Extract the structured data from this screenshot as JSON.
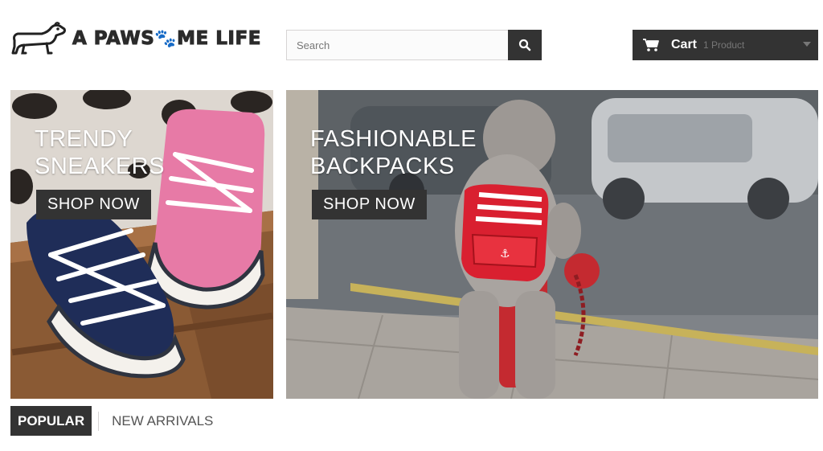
{
  "header": {
    "logo_text_left": "A PAWS",
    "logo_text_right": "ME LIFE",
    "logo_paw_glyph": "🐾",
    "search_placeholder": "Search",
    "cart_label": "Cart",
    "cart_count": "1 Product"
  },
  "banners": [
    {
      "title_line1": "TRENDY",
      "title_line2": "SNEAKERS",
      "button_label": "SHOP NOW"
    },
    {
      "title_line1": "FASHIONABLE",
      "title_line2": "BACKPACKS",
      "button_label": "SHOP NOW"
    }
  ],
  "tabs": [
    {
      "label": "POPULAR",
      "active": true
    },
    {
      "label": "NEW ARRIVALS",
      "active": false
    }
  ],
  "colors": {
    "dark": "#333333",
    "accent_red": "#c8202a"
  },
  "icons": {
    "search": "search-icon",
    "cart": "cart-icon",
    "dropdown": "chevron-down-icon",
    "logo": "dachshund-logo"
  }
}
